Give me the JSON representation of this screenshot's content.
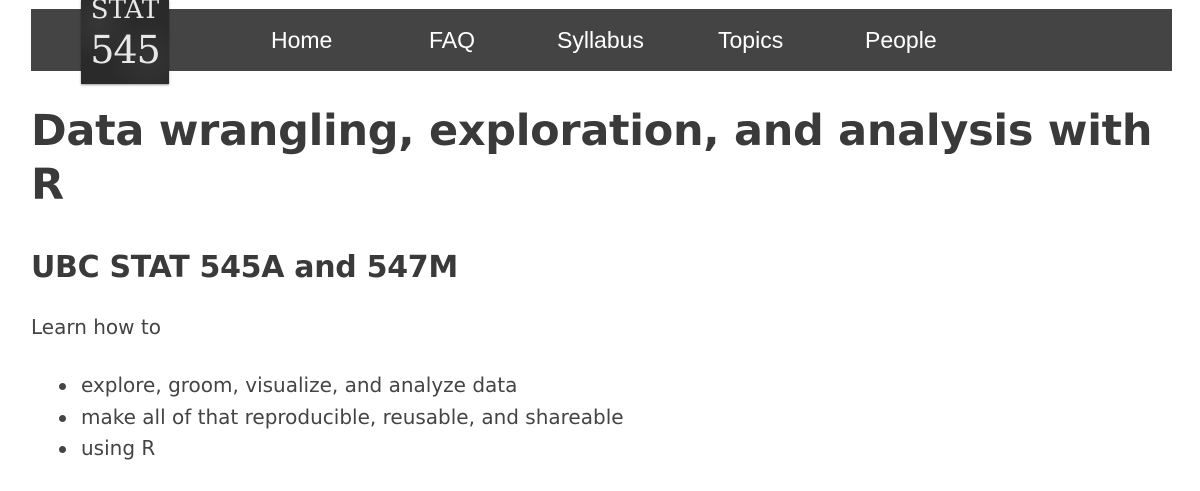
{
  "logo": {
    "line1": "STAT",
    "line2": "545"
  },
  "nav": {
    "items": [
      {
        "label": "Home"
      },
      {
        "label": "FAQ"
      },
      {
        "label": "Syllabus"
      },
      {
        "label": "Topics"
      },
      {
        "label": "People"
      }
    ]
  },
  "main": {
    "title": "Data wrangling, exploration, and analysis with R",
    "subtitle": "UBC STAT 545A and 547M",
    "intro": "Learn how to",
    "bullets": [
      "explore, groom, visualize, and analyze data",
      "make all of that reproducible, reusable, and shareable",
      "using R"
    ]
  },
  "colors": {
    "navbar_bg": "#444444",
    "nav_text": "#ffffff",
    "logo_bg": "#2a2a2a",
    "heading_text": "#3a3a3a",
    "body_text": "#444444"
  }
}
